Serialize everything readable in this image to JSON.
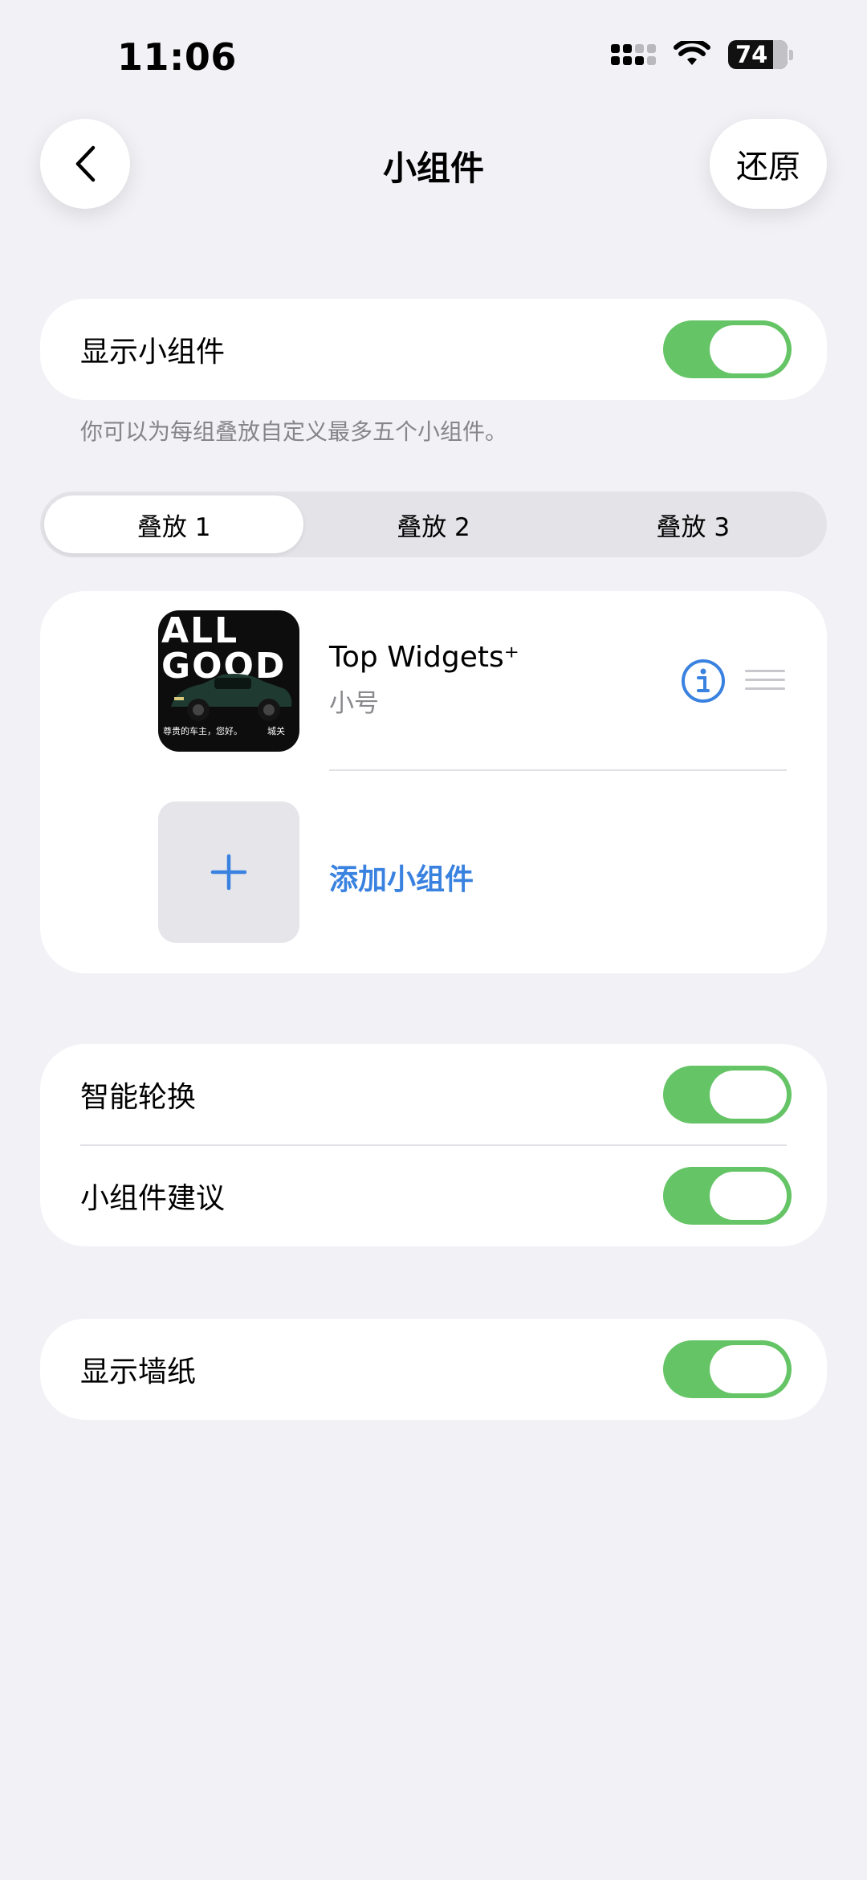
{
  "status_bar": {
    "time": "11:06",
    "battery": "74"
  },
  "nav": {
    "title": "小组件",
    "restore_label": "还原"
  },
  "show_widgets": {
    "label": "显示小组件",
    "enabled": true
  },
  "footnote": "你可以为每组叠放自定义最多五个小组件。",
  "segments": [
    "叠放 1",
    "叠放 2",
    "叠放 3"
  ],
  "selected_segment": 0,
  "widget_list": {
    "items": [
      {
        "title": "Top Widgets⁺",
        "subtitle": "小号",
        "thumb_brand": "ALL\nGOOD",
        "thumb_caption": "尊贵的车主，您好。",
        "thumb_caption2": "城关"
      }
    ],
    "add_label": "添加小组件"
  },
  "options": [
    {
      "label": "智能轮换",
      "enabled": true
    },
    {
      "label": "小组件建议",
      "enabled": true
    }
  ],
  "wallpaper": {
    "label": "显示墙纸",
    "enabled": true
  },
  "colors": {
    "accent": "#3a82e0",
    "toggle_on": "#65c466",
    "background": "#f1f1f6"
  },
  "icons": [
    "back-chevron-icon",
    "info-icon",
    "drag-handle-icon",
    "plus-icon",
    "wifi-icon",
    "cellular-signal-icon",
    "battery-icon"
  ]
}
